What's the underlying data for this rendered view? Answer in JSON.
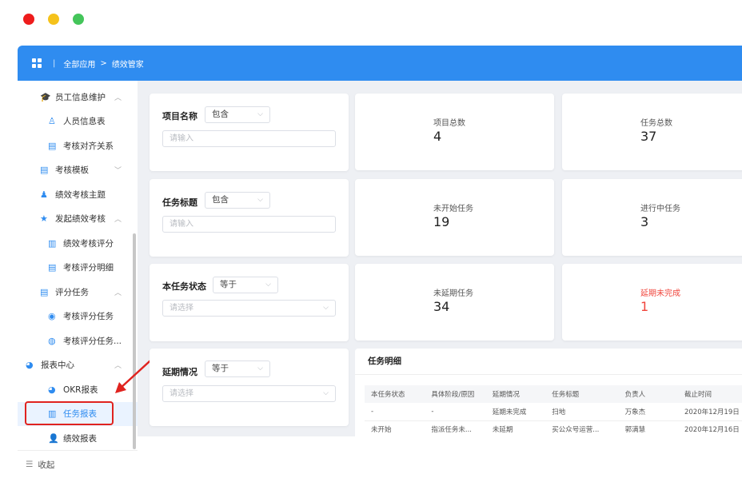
{
  "window": {
    "colors": {
      "close": "#ee1c1c",
      "minimize": "#f5c21b",
      "maximize": "#44c55a"
    }
  },
  "topbar": {
    "accent": "#2f8cf0",
    "separator": "|",
    "breadcrumb": [
      "全部应用",
      "绩效管家"
    ],
    "breadcrumb_arrow": ">"
  },
  "sidebar": {
    "items": [
      {
        "label": "员工信息维护",
        "icon": "graduation-cap-icon",
        "caret": "^",
        "level": 1
      },
      {
        "label": "人员信息表",
        "icon": "user-gear-icon",
        "level": 2
      },
      {
        "label": "考核对齐关系",
        "icon": "document-icon",
        "level": 2
      },
      {
        "label": "考核模板",
        "icon": "template-icon",
        "caret": "v",
        "level": 1
      },
      {
        "label": "绩效考核主题",
        "icon": "user-theme-icon",
        "level": 1
      },
      {
        "label": "发起绩效考核",
        "icon": "star-icon",
        "caret": "^",
        "level": 1
      },
      {
        "label": "绩效考核评分",
        "icon": "bar-chart-icon",
        "level": 2
      },
      {
        "label": "考核评分明细",
        "icon": "document-icon",
        "level": 2
      },
      {
        "label": "评分任务",
        "icon": "document-icon",
        "caret": "^",
        "level": 1
      },
      {
        "label": "考核评分任务",
        "icon": "circle-target-icon",
        "level": 2
      },
      {
        "label": "考核评分任务...",
        "icon": "planet-icon",
        "level": 2
      },
      {
        "label": "报表中心",
        "icon": "pie-chart-icon",
        "caret": "^",
        "level": 1
      },
      {
        "label": "OKR报表",
        "icon": "pie-chart-icon",
        "level": 2
      },
      {
        "label": "任务报表",
        "icon": "bar-chart-icon",
        "level": 2,
        "active": true
      },
      {
        "label": "绩效报表",
        "icon": "person-icon",
        "level": 2
      }
    ],
    "footer_label": "收起",
    "footer_icon": "collapse-menu-icon"
  },
  "filters": [
    {
      "label": "项目名称",
      "operator": "包含",
      "placeholder": "请输入",
      "kind": "input"
    },
    {
      "label": "任务标题",
      "operator": "包含",
      "placeholder": "请输入",
      "kind": "input"
    },
    {
      "label": "本任务状态",
      "operator": "等于",
      "placeholder": "请选择",
      "kind": "select"
    },
    {
      "label": "延期情况",
      "operator": "等于",
      "placeholder": "请选择",
      "kind": "select"
    }
  ],
  "stats": [
    {
      "label": "项目总数",
      "value": "4"
    },
    {
      "label": "任务总数",
      "value": "37"
    },
    {
      "label": "未开始任务",
      "value": "19"
    },
    {
      "label": "进行中任务",
      "value": "3"
    },
    {
      "label": "未延期任务",
      "value": "34"
    },
    {
      "label": "延期未完成",
      "value": "1",
      "color": "#f0453c"
    }
  ],
  "detail": {
    "title": "任务明细",
    "columns": [
      "本任务状态",
      "具体阶段/原因",
      "延期情况",
      "任务标题",
      "负责人",
      "截止时间"
    ],
    "rows": [
      [
        "-",
        "-",
        "延期未完成",
        "扫地",
        "万象杰",
        "2020年12月19日"
      ],
      [
        "未开始",
        "指派任务未...",
        "未延期",
        "买公众号运营...",
        "郭满慧",
        "2020年12月16日"
      ]
    ]
  }
}
